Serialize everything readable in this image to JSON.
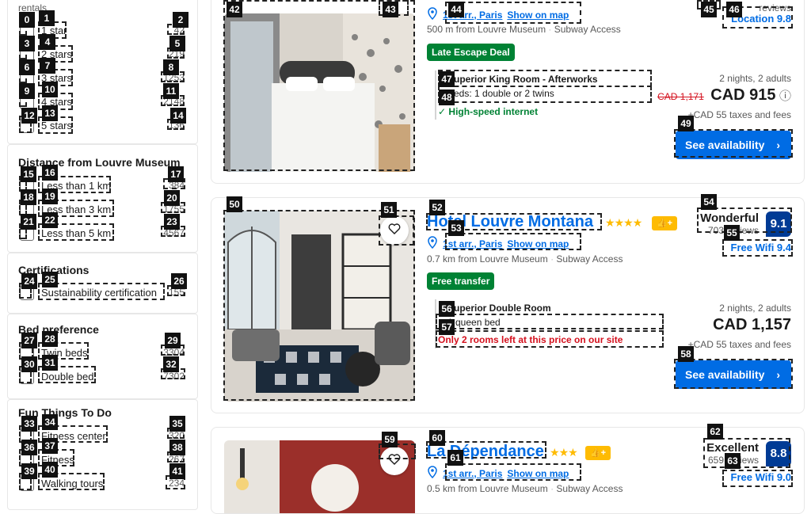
{
  "sidebar": {
    "top_cut_text": "rentals",
    "rating": {
      "items": [
        {
          "label": "1 star",
          "count": "42"
        },
        {
          "label": "2 stars",
          "count": "219"
        },
        {
          "label": "3 stars",
          "count": "1253"
        },
        {
          "label": "4 stars",
          "count": "2148"
        },
        {
          "label": "5 stars",
          "count": "136"
        }
      ]
    },
    "distance": {
      "title": "Distance from Louvre Museum",
      "items": [
        {
          "label": "Less than 1 km",
          "count": "384"
        },
        {
          "label": "Less than 3 km",
          "count": "1755"
        },
        {
          "label": "Less than 5 km",
          "count": "4567"
        }
      ]
    },
    "certifications": {
      "title": "Certifications",
      "items": [
        {
          "label": "Sustainability certification",
          "count": "155"
        }
      ]
    },
    "bed": {
      "title": "Bed preference",
      "items": [
        {
          "label": "Twin beds",
          "count": "3304"
        },
        {
          "label": "Double bed",
          "count": "7302"
        }
      ]
    },
    "fun": {
      "title": "Fun Things To Do",
      "items": [
        {
          "label": "Fitness center",
          "count": "320"
        },
        {
          "label": "Fitness",
          "count": "267"
        },
        {
          "label": "Walking tours",
          "count": "234"
        }
      ]
    }
  },
  "cards": [
    {
      "district": "1st arr., Paris",
      "show_on_map": "Show on map",
      "distance": "500 m from Louvre Museum",
      "transit": "Subway Access",
      "deal": "Late Escape Deal",
      "room_type": "Superior King Room - Afterworks",
      "bed": "Beds: 1 double or 2 twins",
      "perk": "High-speed internet",
      "reviews": "reviews",
      "sub_score": "Location 9.8",
      "nights": "2 nights, 2 adults",
      "old_price": "CAD 1,171",
      "price": "CAD 915",
      "taxes": "+CAD 55 taxes and fees",
      "button": "See availability"
    },
    {
      "name": "Hotel Louvre Montana",
      "district": "1st arr., Paris",
      "show_on_map": "Show on map",
      "distance": "0.7 km from Louvre Museum",
      "transit": "Subway Access",
      "deal": "Free transfer",
      "room_type": "Superior Double Room",
      "bed": "1 queen bed",
      "warning": "Only 2 rooms left at this price on our site",
      "rating_word": "Wonderful",
      "reviews": "703 reviews",
      "score": "9.1",
      "sub_score": "Free Wifi 9.4",
      "nights": "2 nights, 2 adults",
      "price": "CAD 1,157",
      "taxes": "+CAD 55 taxes and fees",
      "button": "See availability"
    },
    {
      "name": "La Dépendance",
      "district": "1st arr., Paris",
      "show_on_map": "Show on map",
      "distance": "0.5 km from Louvre Museum",
      "transit": "Subway Access",
      "rating_word": "Excellent",
      "reviews": "659 reviews",
      "score": "8.8",
      "sub_score": "Free Wifi 9.0"
    }
  ],
  "icons": {
    "star": "★",
    "preferred": "👍+",
    "chevron": "›",
    "check": "✓",
    "info": "ⓘ"
  },
  "colors": {
    "link": "#006ce4",
    "score_bg": "#003b95",
    "deal_green": "#008234",
    "warn_red": "#d4111e"
  },
  "markers": [
    "0",
    "1",
    "2",
    "3",
    "4",
    "5",
    "6",
    "7",
    "8",
    "9",
    "10",
    "11",
    "12",
    "13",
    "14",
    "15",
    "16",
    "17",
    "18",
    "19",
    "20",
    "21",
    "22",
    "23",
    "24",
    "25",
    "26",
    "27",
    "28",
    "29",
    "30",
    "31",
    "32",
    "33",
    "34",
    "35",
    "36",
    "37",
    "38",
    "39",
    "40",
    "41",
    "42",
    "43",
    "44",
    "45",
    "46",
    "47",
    "48",
    "49",
    "50",
    "51",
    "52",
    "53",
    "54",
    "55",
    "56",
    "57",
    "58",
    "59",
    "60",
    "61",
    "62",
    "63"
  ]
}
